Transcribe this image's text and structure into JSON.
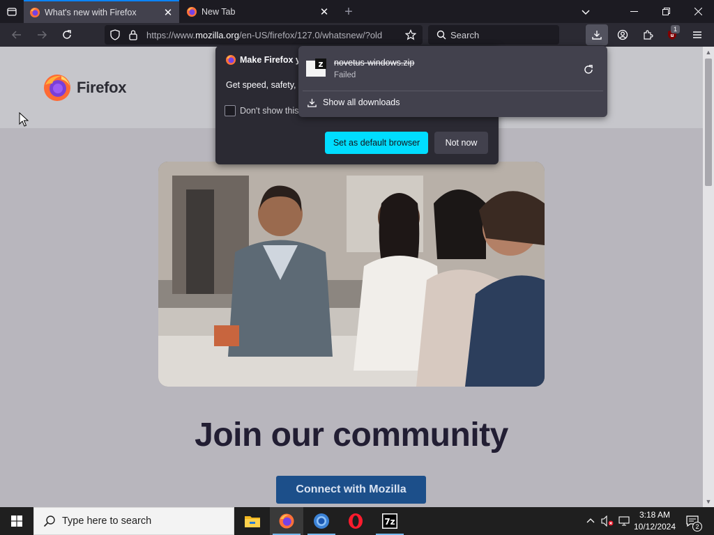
{
  "tabs": [
    {
      "title": "What's new with Firefox",
      "active": true
    },
    {
      "title": "New Tab",
      "active": false
    }
  ],
  "urlbar": {
    "url_prefix": "https://www.",
    "url_domain": "mozilla.org",
    "url_path": "/en-US/firefox/127.0/whatsnew/?old"
  },
  "searchbar": {
    "placeholder": "Search"
  },
  "toolbar": {
    "extension_badge": "1"
  },
  "page": {
    "brand": "Firefox",
    "heading": "Join our community",
    "cta_label": "Connect with Mozilla"
  },
  "default_panel": {
    "title": "Make Firefox yc",
    "body": "Get speed, safety, a",
    "checkbox_label": "Don't show this",
    "primary_button": "Set as default browser",
    "secondary_button": "Not now"
  },
  "downloads_panel": {
    "file_name": "novetus-windows.zip",
    "status": "Failed",
    "show_all": "Show all downloads"
  },
  "taskbar": {
    "search_placeholder": "Type here to search",
    "time": "3:18 AM",
    "date": "10/12/2024",
    "notification_count": "2"
  },
  "colors": {
    "accent": "#0a84ff",
    "cta_cyan": "#00ddff",
    "page_bg": "#b8b6bd",
    "heading": "#221e33",
    "cta_button": "#1c4f8a"
  }
}
